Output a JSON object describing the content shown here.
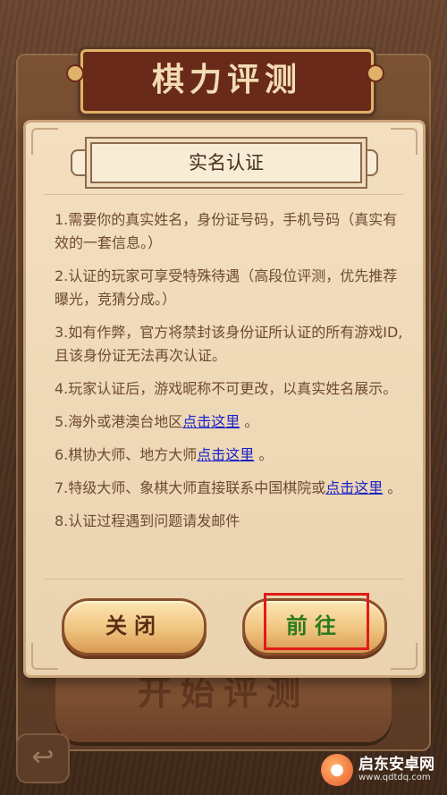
{
  "header": {
    "title": "棋力评测"
  },
  "background": {
    "start_button_label": "开始评测",
    "back_icon": "back-arrow-icon"
  },
  "dialog": {
    "title": "实名认证",
    "items": [
      {
        "text": "1.需要你的真实姓名，身份证号码，手机号码（真实有效的一套信息。）"
      },
      {
        "text": "2.认证的玩家可享受特殊待遇（高段位评测，优先推荐曝光，竞猜分成。）"
      },
      {
        "text": "3.如有作弊，官方将禁封该身份证所认证的所有游戏ID,且该身份证无法再次认证。"
      },
      {
        "text": "4.玩家认证后，游戏昵称不可更改，以真实姓名展示。"
      },
      {
        "text": "5.海外或港澳台地区",
        "link": "点击这里",
        "suffix": " 。"
      },
      {
        "text": "6.棋协大师、地方大师",
        "link": "点击这里",
        "suffix": " 。"
      },
      {
        "text": "7.特级大师、象棋大师直接联系中国棋院或",
        "link": "点击这里",
        "suffix": " 。"
      },
      {
        "text": "8.认证过程遇到问题请发邮件"
      }
    ],
    "buttons": {
      "close": "关闭",
      "go": "前往"
    }
  },
  "watermark": {
    "line1": "启东安卓网",
    "line2": "www.qdtdq.com"
  },
  "colors": {
    "link": "#1c22c9",
    "go_text": "#2b7a1c",
    "highlight": "#e21a1a"
  }
}
